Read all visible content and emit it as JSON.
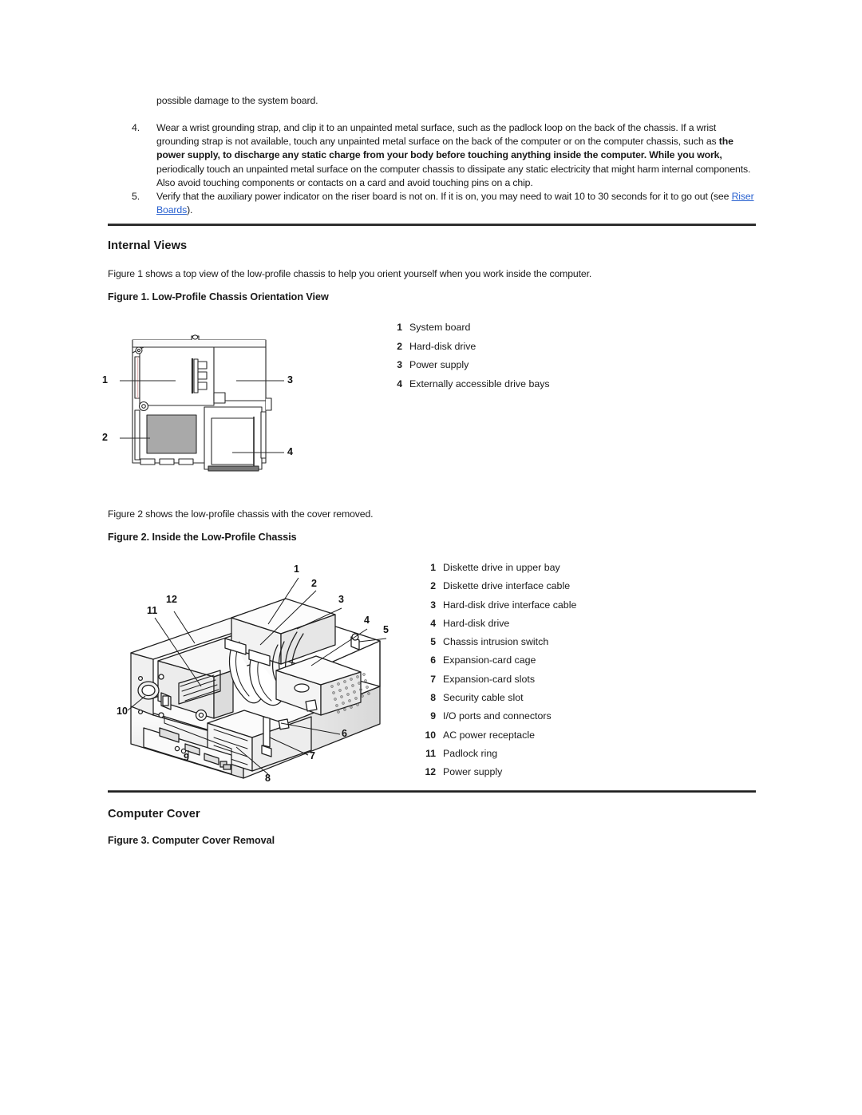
{
  "document": {
    "intro_line": "possible damage to the system board.",
    "steps": [
      {
        "number": "4.",
        "parts": [
          {
            "text": "Wear a wrist grounding strap, and clip it to an unpainted metal surface, such as the padlock loop on the back of the chassis. If a wrist grounding strap is not available, touch any unpainted metal surface on the back of the computer or on the computer chassis, such as ",
            "bold": false
          },
          {
            "text": "the power supply, to discharge any static charge from your body before touching anything inside the computer.  While you work,",
            "bold": true
          },
          {
            "text": " periodically touch an unpainted metal surface on the computer chassis to dissipate any static electricity that might harm internal components. Also avoid touching components or contacts on a card and avoid touching pins on a chip.",
            "bold": false
          }
        ]
      },
      {
        "number": "5.",
        "parts": [
          {
            "text": "Verify that the auxiliary power indicator on the riser board is not on. If it is on, you may need to wait 10 to 30 seconds for it to go out (see ",
            "bold": false
          },
          {
            "text": "Riser Boards",
            "bold": false,
            "link": true
          },
          {
            "text": ").",
            "bold": false
          }
        ]
      }
    ],
    "sections": [
      {
        "heading": "Internal Views",
        "paragraph": "Figure 1 shows a top view of the low-profile chassis to help you orient yourself when you work inside the computer."
      },
      {
        "heading": "Computer Cover"
      }
    ],
    "figures": [
      {
        "caption": "Figure 1. Low-Profile Chassis Orientation View",
        "legend": [
          {
            "num": "1",
            "label": "System board"
          },
          {
            "num": "2",
            "label": "Hard-disk drive"
          },
          {
            "num": "3",
            "label": "Power supply"
          },
          {
            "num": "4",
            "label": "Externally accessible drive bays"
          }
        ],
        "callouts": [
          "1",
          "2",
          "3",
          "4"
        ]
      },
      {
        "intro": "Figure 2 shows the low-profile chassis with the cover removed.",
        "caption": "Figure 2. Inside the Low-Profile Chassis",
        "legend": [
          {
            "num": "1",
            "label": "Diskette drive in upper bay"
          },
          {
            "num": "2",
            "label": "Diskette drive interface cable"
          },
          {
            "num": "3",
            "label": "Hard-disk drive interface cable"
          },
          {
            "num": "4",
            "label": "Hard-disk drive"
          },
          {
            "num": "5",
            "label": "Chassis intrusion switch"
          },
          {
            "num": "6",
            "label": "Expansion-card cage"
          },
          {
            "num": "7",
            "label": "Expansion-card slots"
          },
          {
            "num": "8",
            "label": "Security cable slot"
          },
          {
            "num": "9",
            "label": "I/O ports and connectors"
          },
          {
            "num": "10",
            "label": "AC power receptacle"
          },
          {
            "num": "11",
            "label": "Padlock ring"
          },
          {
            "num": "12",
            "label": "Power supply"
          }
        ],
        "callouts": [
          "1",
          "2",
          "3",
          "4",
          "5",
          "6",
          "7",
          "8",
          "9",
          "10",
          "11",
          "12"
        ]
      },
      {
        "caption": "Figure 3. Computer Cover Removal"
      }
    ],
    "link_color": "#2a62d0",
    "rule_color": "#222222"
  }
}
